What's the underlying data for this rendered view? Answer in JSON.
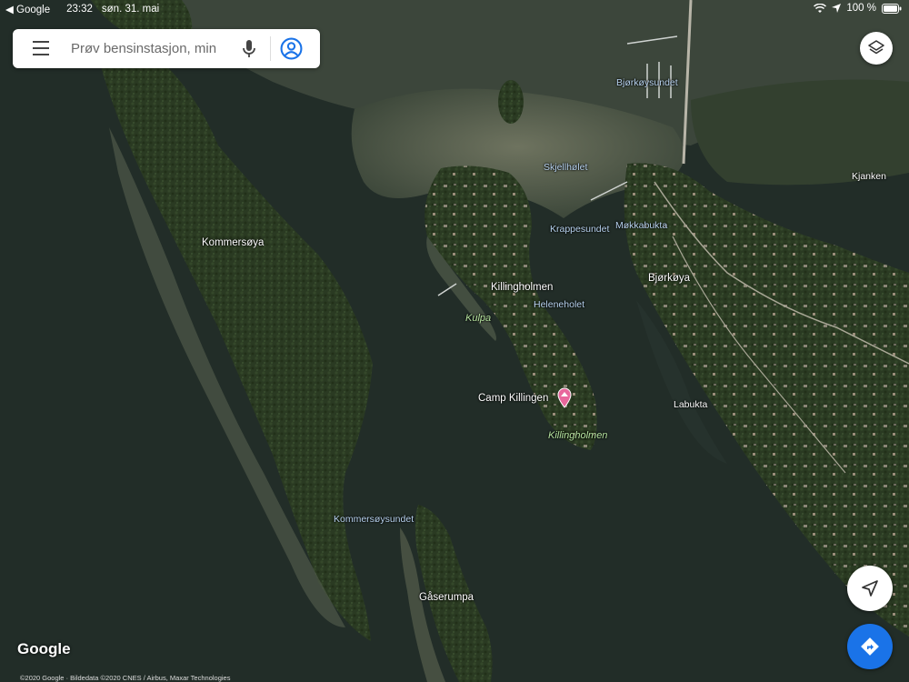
{
  "status_bar": {
    "back_app": "◀ Google",
    "time": "23:32",
    "date": "søn. 31. mai",
    "battery": "100 %"
  },
  "search": {
    "placeholder": "Prøv bensinstasjon, min"
  },
  "labels": {
    "kommersoya": "Kommersøya",
    "bjorkoysundet": "Bjørkøysundet",
    "skjellholet": "Skjellhølet",
    "kjanken": "Kjanken",
    "krappesundet": "Krappesundet",
    "mokkabukta": "Møkkabukta",
    "bjorkoya": "Bjørkøya",
    "killingholmen": "Killingholmen",
    "heleneholet": "Heleneholet",
    "kulpa": "Kulpa",
    "camp_killingen": "Camp Killingen",
    "killingholmen_park": "Killingholmen",
    "labukta": "Labukta",
    "kommersoysundet": "Kommersøysundet",
    "gaserumpa": "Gåserumpa"
  },
  "footer": {
    "logo": "Google",
    "copyright": "©2020 Google · Bildedata ©2020 CNES / Airbus, Maxar Technologies"
  },
  "icons": {
    "menu": "menu-icon",
    "mic": "mic-icon",
    "account": "account-icon",
    "layers": "layers-icon",
    "locate": "navigation-arrow-icon",
    "directions": "directions-icon",
    "pin": "camping-pin-icon"
  },
  "colors": {
    "water": "#24312b",
    "shallow": "#5c6552",
    "forest": "#2b3b22",
    "directions_blue": "#1a73e8",
    "pin_pink": "#e8679c"
  }
}
